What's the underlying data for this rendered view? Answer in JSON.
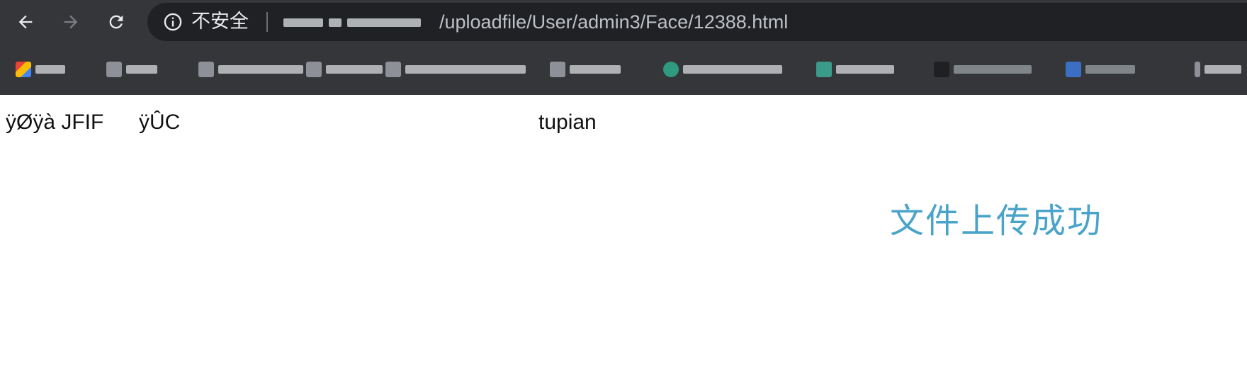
{
  "browser": {
    "security_label": "不安全",
    "url_path": "/uploadfile/User/admin3/Face/12388.html"
  },
  "page": {
    "raw_text_1": "ÿØÿà JFIF",
    "raw_text_2": "ÿÛC",
    "raw_text_3": "tupian",
    "success_message": "文件上传成功"
  },
  "colors": {
    "toolbar_bg": "#35363a",
    "omnibox_bg": "#202124",
    "success_text": "#4aa3c9"
  }
}
